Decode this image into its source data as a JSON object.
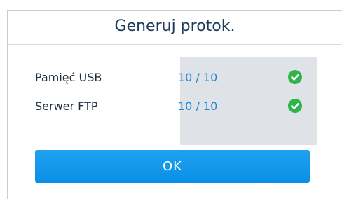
{
  "dialog": {
    "title": "Generuj protok.",
    "rows": [
      {
        "label": "Pamięć USB",
        "value": "10 / 10",
        "status_icon": "check-circle-icon"
      },
      {
        "label": "Serwer FTP",
        "value": "10 / 10",
        "status_icon": "check-circle-icon"
      }
    ],
    "ok_label": "OK"
  },
  "colors": {
    "title_text": "#1f3b5c",
    "value_text": "#1b8ad6",
    "status_panel_bg": "#dfe2e6",
    "check_green": "#2fb44a",
    "button_blue": "#0f95e8"
  }
}
